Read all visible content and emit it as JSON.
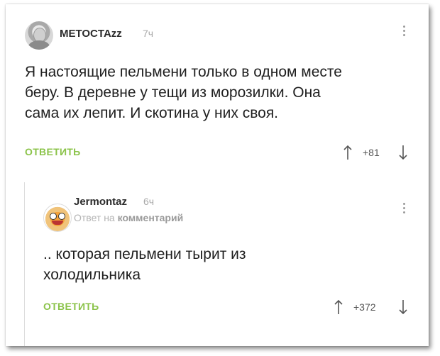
{
  "comment1": {
    "username": "METOCTAzz",
    "time": "7ч",
    "lines": [
      "Я настоящие пельмени только в одном месте",
      "беру. В деревне у тещи из морозилки. Она",
      "сама их лепит. И скотина у них своя."
    ],
    "reply_label": "ОТВЕТИТЬ",
    "rating": "+81"
  },
  "comment2": {
    "username": "Jermontaz",
    "time": "6ч",
    "reply_to_prefix": "Ответ на",
    "reply_to_target": "комментарий",
    "lines": [
      ".. которая пельмени  тырит из",
      "холодильника"
    ],
    "reply_label": "ОТВЕТИТЬ",
    "rating": "+372"
  },
  "colors": {
    "accent": "#8bc34a",
    "text": "#1f1f1f",
    "muted": "#a8a8a8"
  },
  "icons": [
    "user-avatar",
    "more-vertical-icon",
    "arrow-up-icon",
    "arrow-down-icon"
  ]
}
